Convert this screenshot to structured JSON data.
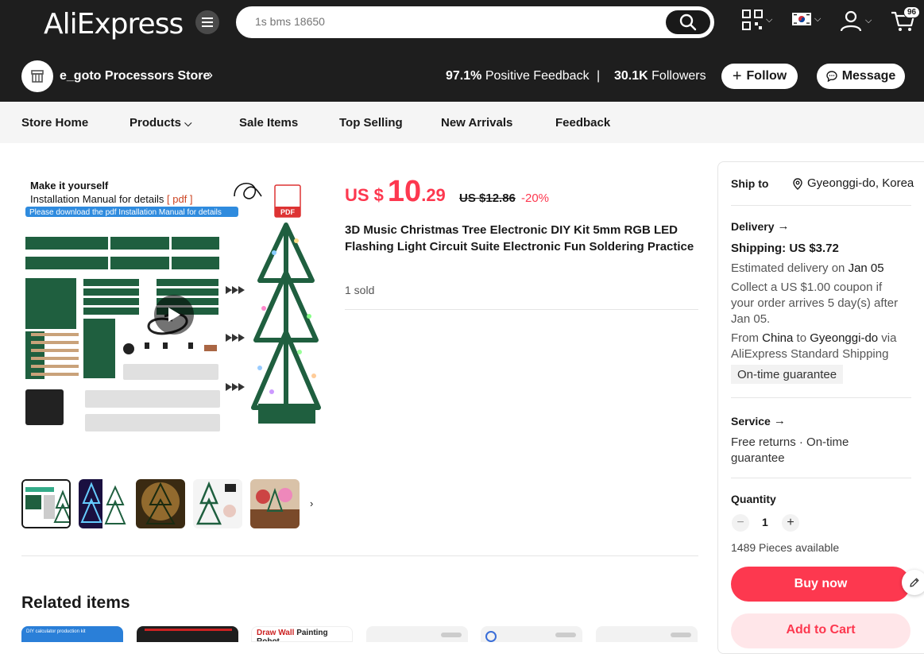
{
  "header": {
    "logo": "AliExpress",
    "search_placeholder": "1s bms 18650",
    "cart_count": "96",
    "icons": [
      "menu-icon",
      "search-icon",
      "qr-code-icon",
      "korea-flag-icon",
      "user-icon",
      "cart-icon"
    ]
  },
  "store": {
    "name": "e_goto Processors Store",
    "feedback_value": "97.1%",
    "feedback_label": "Positive Feedback",
    "followers_value": "30.1K",
    "followers_label": "Followers",
    "follow_label": "Follow",
    "message_label": "Message"
  },
  "nav": {
    "items": [
      "Store Home",
      "Products",
      "Sale Items",
      "Top Selling",
      "New Arrivals",
      "Feedback"
    ]
  },
  "gallery": {
    "heading_1": "Make it yourself",
    "heading_2_prefix": "Installation Manual for details ",
    "heading_2_suffix": "[ pdf ]",
    "banner": "Please download the pdf Installation Manual for details",
    "pdf_label": "PDF"
  },
  "product": {
    "currency": "US $",
    "price_int": "10",
    "price_dec": ".29",
    "old_price": "US $12.86",
    "discount": "-20%",
    "title": "3D Music Christmas Tree Electronic DIY Kit 5mm RGB LED Flashing Light Circuit Suite Electronic Fun Soldering Practice",
    "sold": "1 sold"
  },
  "related": {
    "title": "Related items",
    "card_1_text": "DIY calculator production kit",
    "card_3_text_a": "Draw Wall ",
    "card_3_text_b": "Painting Robot"
  },
  "sidebar": {
    "ship_to_label": "Ship to",
    "ship_to_value": "Gyeonggi-do, Korea",
    "delivery_label": "Delivery",
    "shipping": "Shipping: US $3.72",
    "est_prefix": "Estimated delivery on ",
    "est_date": "Jan 05",
    "coupon_line_1": "Collect a US $1.00 coupon if",
    "coupon_line_2": "your order arrives 5 day(s) after",
    "coupon_line_3": "Jan 05.",
    "from_prefix": "From ",
    "from_country": "China",
    "from_to": " to ",
    "from_dest": "Gyeonggi-do",
    "from_via": " via",
    "shipping_method": "AliExpress Standard Shipping",
    "guarantee_badge": "On-time guarantee",
    "service_label": "Service",
    "service_line_1": "Free returns · On-time",
    "service_line_2": "guarantee",
    "quantity_label": "Quantity",
    "quantity_value": "1",
    "available": "1489 Pieces available",
    "buy_now": "Buy now",
    "add_to_cart": "Add to Cart"
  },
  "colors": {
    "accent": "#fd384f",
    "header_bg": "#1e1e1e",
    "pcb_green": "#1f5f3f"
  }
}
